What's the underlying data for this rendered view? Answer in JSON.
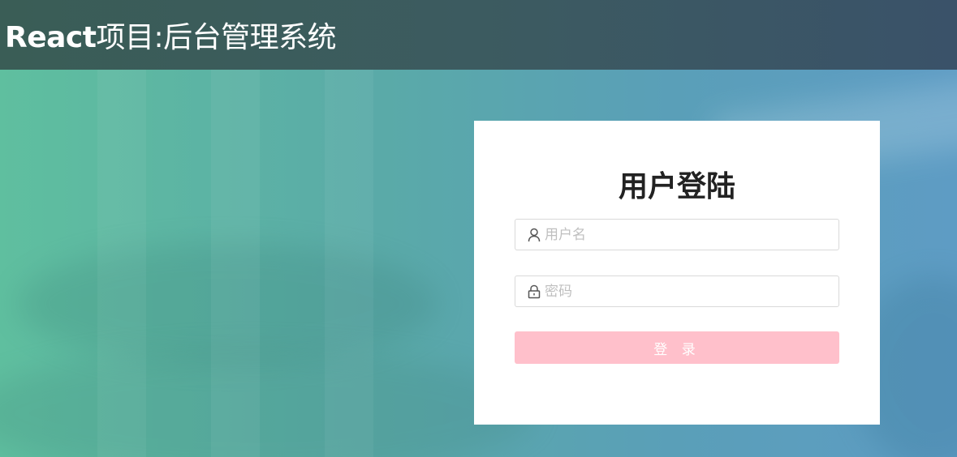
{
  "header": {
    "title_prefix": "React",
    "title_rest": "项目:后台管理系统"
  },
  "login": {
    "title": "用户登陆",
    "username": {
      "placeholder": "用户名",
      "value": "",
      "icon": "user-icon"
    },
    "password": {
      "placeholder": "密码",
      "value": "",
      "icon": "lock-icon"
    },
    "submit_label": "登 录"
  },
  "colors": {
    "header_bg": "#3b5a5f",
    "button_bg": "#ffc0cb",
    "card_bg": "#ffffff",
    "title_text": "#222222"
  }
}
